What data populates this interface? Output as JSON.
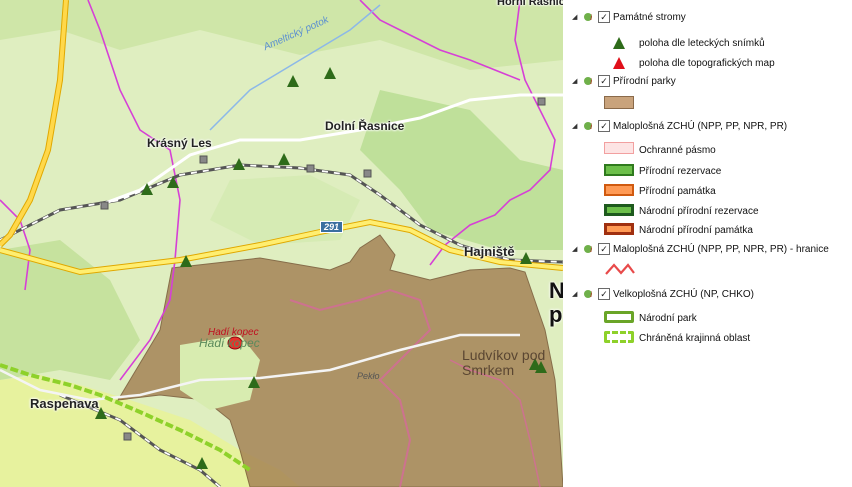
{
  "map": {
    "places": {
      "krasny_les": "Krásný Les",
      "dolni_rasnice": "Dolní Řasnice",
      "hajniste": "Hajniště",
      "raspenava": "Raspenava",
      "ludvikov": "Ludvíkov pod Smrkem",
      "big_letter_1": "N",
      "big_letter_2": "p"
    },
    "river": "Ameltický potok",
    "hill_red": "Hadí kopec",
    "hill_green": "Hadí kopec",
    "area_label": "Pekło",
    "road_number": "291",
    "top_right_label": "Horní Řasnice"
  },
  "legend": {
    "layers": [
      {
        "label": "Památné stromy",
        "checked": true
      },
      {
        "label": "Přírodní parky",
        "checked": true
      },
      {
        "label": "Maloplošná ZCHÚ (NPP, PP, NPR, PR)",
        "checked": true
      },
      {
        "label": "Maloplošná ZCHÚ (NPP, PP, NPR, PR) - hranice",
        "checked": true
      },
      {
        "label": "Velkoplošná ZCHÚ (NP, CHKO)",
        "checked": true
      }
    ],
    "trees": [
      {
        "label": "poloha dle leteckých snímků",
        "color": "#2e6b1a"
      },
      {
        "label": "poloha dle topografických map",
        "color": "#e0101a"
      }
    ],
    "zchu": [
      {
        "label": "Ochranné pásmo",
        "fill": "#fde4e4",
        "stroke": "#f2a0a0"
      },
      {
        "label": "Přírodní rezervace",
        "fill": "#6cbf4a",
        "stroke": "#2f7a1e"
      },
      {
        "label": "Přírodní památka",
        "fill": "#ff9a55",
        "stroke": "#d05a10"
      },
      {
        "label": "Národní přírodní rezervace",
        "fill": "#6cbf4a",
        "stroke": "#1e5a1e"
      },
      {
        "label": "Národní přírodní památka",
        "fill": "#ff9a55",
        "stroke": "#a03010"
      }
    ],
    "boundary_color": "#e84a4a",
    "park_fill": "#c9a37c",
    "large": [
      {
        "label": "Národní park",
        "color": "#6aa528"
      },
      {
        "label": "Chráněná krajinná oblast",
        "color": "#8ed12a"
      }
    ]
  }
}
